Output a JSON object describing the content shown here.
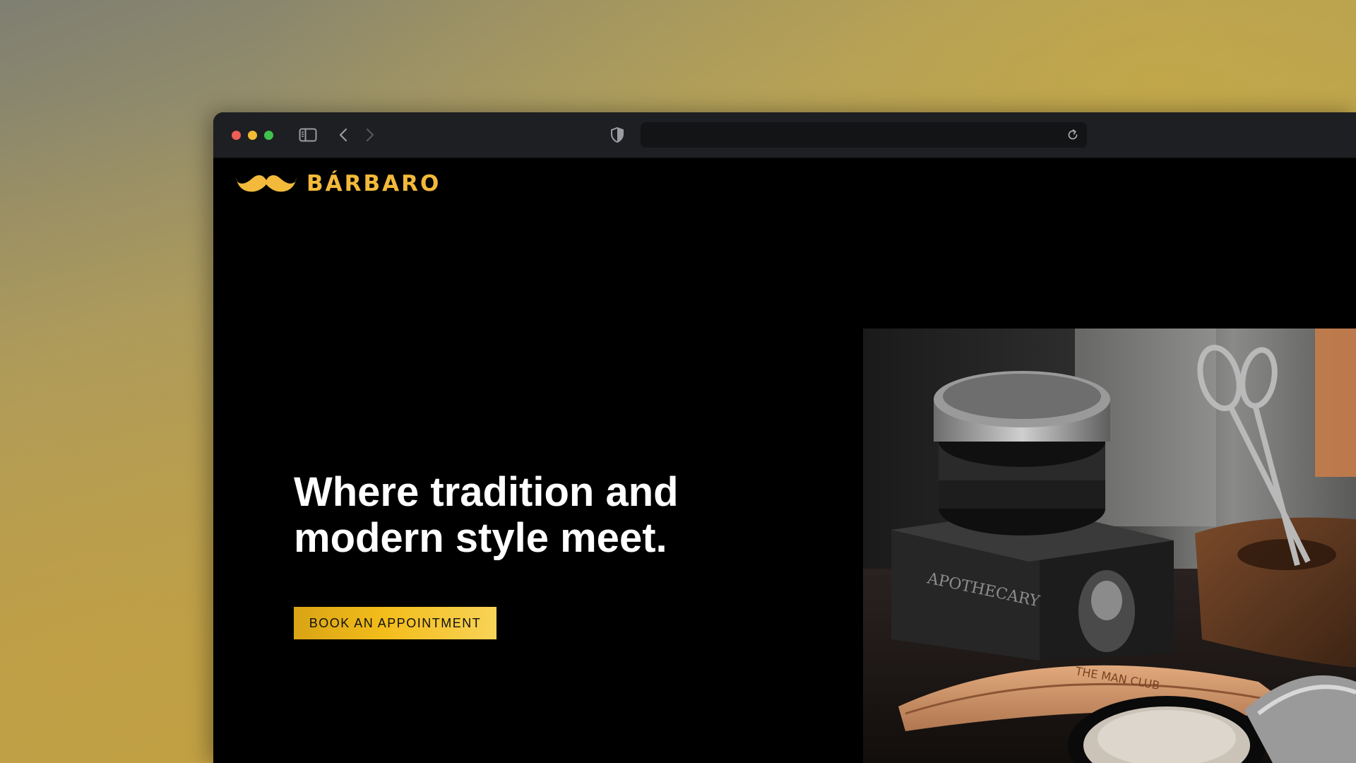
{
  "brand": {
    "name": "BÁRBARO",
    "accent_color": "#f2b93a"
  },
  "browser": {
    "controls": [
      "close",
      "minimize",
      "zoom"
    ],
    "icons": [
      "sidebar-icon",
      "back-icon",
      "forward-icon",
      "privacy-shield-icon",
      "reload-icon"
    ],
    "address": ""
  },
  "hero": {
    "title_line1": "Where tradition and",
    "title_line2": "modern style meet.",
    "cta_label": "BOOK AN APPOINTMENT",
    "cta_color": "#f3bd1b"
  },
  "photo": {
    "comb_text": "THE MAN CLUB",
    "jar_text": "APOTHECARY"
  }
}
